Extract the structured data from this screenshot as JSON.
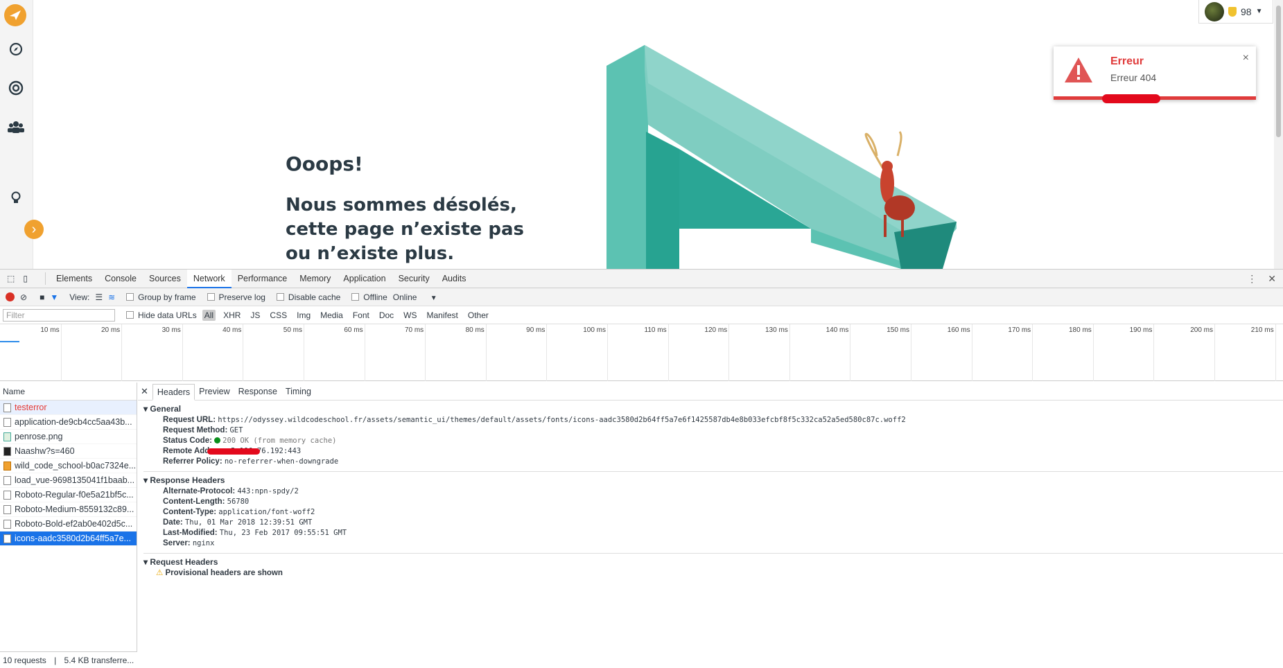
{
  "page": {
    "heading": "Ooops!",
    "message": "Nous sommes désolés, cette page n’existe pas ou n’existe plus."
  },
  "user": {
    "points": "98"
  },
  "toast": {
    "title": "Erreur",
    "message": "Erreur 404",
    "close": "×"
  },
  "devtools": {
    "tabs": [
      "Elements",
      "Console",
      "Sources",
      "Network",
      "Performance",
      "Memory",
      "Application",
      "Security",
      "Audits"
    ],
    "toolbar": {
      "view_label": "View:",
      "group_by_frame": "Group by frame",
      "preserve_log": "Preserve log",
      "disable_cache": "Disable cache",
      "offline": "Offline",
      "throttle": "Online"
    },
    "filter": {
      "placeholder": "Filter",
      "hide_data_urls": "Hide data URLs",
      "types": [
        "All",
        "XHR",
        "JS",
        "CSS",
        "Img",
        "Media",
        "Font",
        "Doc",
        "WS",
        "Manifest",
        "Other"
      ]
    },
    "timeline_ticks": [
      "10 ms",
      "20 ms",
      "30 ms",
      "40 ms",
      "50 ms",
      "60 ms",
      "70 ms",
      "80 ms",
      "90 ms",
      "100 ms",
      "110 ms",
      "120 ms",
      "130 ms",
      "140 ms",
      "150 ms",
      "160 ms",
      "170 ms",
      "180 ms",
      "190 ms",
      "200 ms",
      "210 ms"
    ],
    "names_header": "Name",
    "requests": [
      "testerror",
      "application-de9cb4cc5aa43b...",
      "penrose.png",
      "Naashw?s=460",
      "wild_code_school-b0ac7324e...",
      "load_vue-9698135041f1baab...",
      "Roboto-Regular-f0e5a21bf5c...",
      "Roboto-Medium-8559132c89...",
      "Roboto-Bold-ef2ab0e402d5c...",
      "icons-aadc3580d2b64ff5a7e..."
    ],
    "footer": {
      "requests": "10 requests",
      "separator": "|",
      "transferred": "5.4 KB transferre..."
    },
    "detail_tabs": [
      "Headers",
      "Preview",
      "Response",
      "Timing"
    ],
    "general": {
      "title": "General",
      "request_url_k": "Request URL:",
      "request_url_v": "https://odyssey.wildcodeschool.fr/assets/semantic_ui/themes/default/assets/fonts/icons-aadc3580d2b64ff5a7e6f1425587db4e8b033efcbf8f5c332ca52a5ed580c87c.woff2",
      "method_k": "Request Method:",
      "method_v": "GET",
      "status_k": "Status Code:",
      "status_v": "200 OK (from memory cache)",
      "remote_k": "Remote Address:",
      "remote_v": "5.196.76.192:443",
      "referrer_k": "Referrer Policy:",
      "referrer_v": "no-referrer-when-downgrade"
    },
    "response_headers": {
      "title": "Response Headers",
      "items": [
        {
          "k": "Alternate-Protocol:",
          "v": "443:npn-spdy/2"
        },
        {
          "k": "Content-Length:",
          "v": "56780"
        },
        {
          "k": "Content-Type:",
          "v": "application/font-woff2"
        },
        {
          "k": "Date:",
          "v": "Thu, 01 Mar 2018 12:39:51 GMT"
        },
        {
          "k": "Last-Modified:",
          "v": "Thu, 23 Feb 2017 09:55:51 GMT"
        },
        {
          "k": "Server:",
          "v": "nginx"
        }
      ]
    },
    "request_headers": {
      "title": "Request Headers",
      "warning": "Provisional headers are shown"
    }
  },
  "colors": {
    "accent": "#f0a12f",
    "teal": "#5cc2b2",
    "error": "#e03b3b",
    "devtools_blue": "#1a73e8"
  }
}
